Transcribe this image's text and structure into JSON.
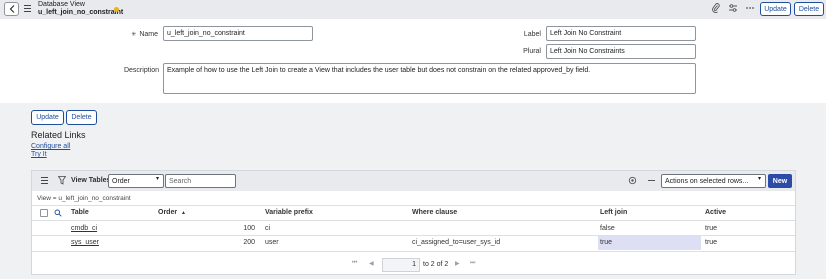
{
  "header": {
    "record_type": "Database View",
    "record_name": "u_left_join_no_constraint",
    "update_label": "Update",
    "delete_label": "Delete"
  },
  "form": {
    "name_label": "Name",
    "name_value": "u_left_join_no_constraint",
    "label_label": "Label",
    "label_value": "Left Join No Constraint",
    "plural_label": "Plural",
    "plural_value": "Left Join No Constraints",
    "description_label": "Description",
    "description_value": "Example of how to use the Left Join to create a View that includes the user table but does not constrain on the related approved_by field."
  },
  "actions": {
    "update_label": "Update",
    "delete_label": "Delete"
  },
  "related_links": {
    "title": "Related Links",
    "items": [
      "Configure all",
      "Try It"
    ]
  },
  "list": {
    "title": "View Tables",
    "field_select": "Order",
    "search_placeholder": "Search",
    "actions_select": "Actions on selected rows...",
    "new_label": "New",
    "breadcrumb": "View = u_left_join_no_constraint",
    "columns": [
      "Table",
      "Order",
      "Variable prefix",
      "Where clause",
      "Left join",
      "Active"
    ],
    "sort_indicator": "▲",
    "rows": [
      {
        "table": "cmdb_ci",
        "order": "100",
        "prefix": "ci",
        "where": "",
        "left_join": "false",
        "active": "true"
      },
      {
        "table": "sys_user",
        "order": "200",
        "prefix": "user",
        "where": "ci_assigned_to=user_sys_id",
        "left_join": "true",
        "active": "true"
      }
    ],
    "pager": {
      "page": "1",
      "of_text": "to 2 of 2"
    }
  },
  "colors": {
    "accent": "#1f4f9c",
    "new_button": "#2b4ba6",
    "highlight": "#dde0f4"
  }
}
